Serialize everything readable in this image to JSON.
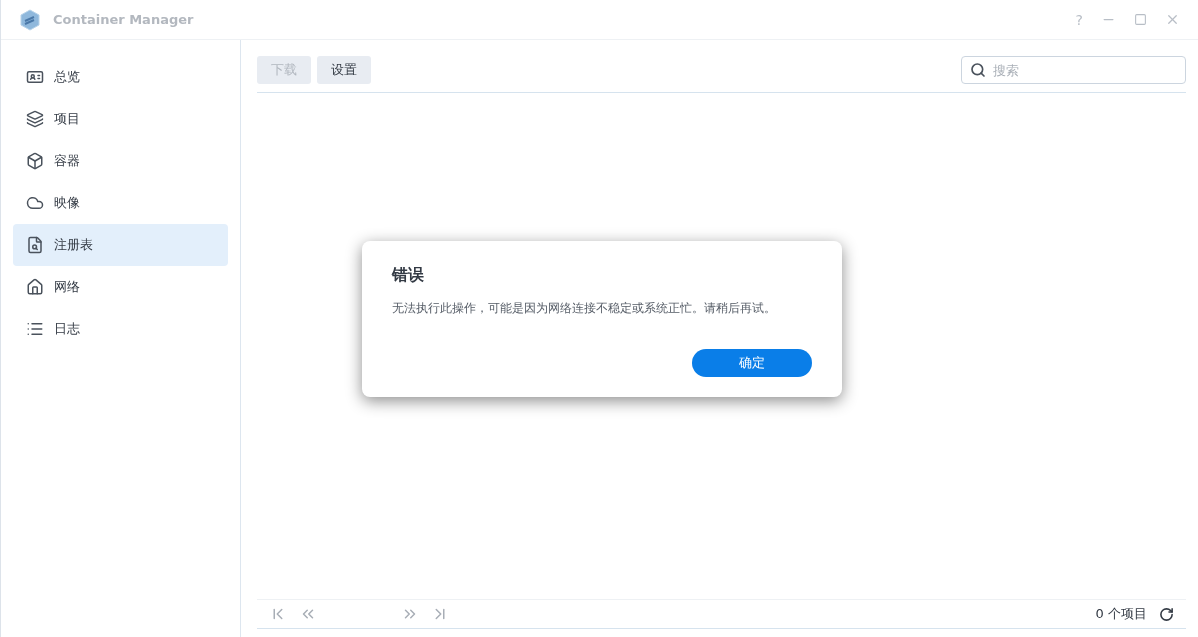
{
  "window": {
    "title": "Container Manager",
    "help": "?"
  },
  "sidebar": {
    "items": [
      {
        "label": "总览",
        "kind": "overview",
        "selected": false
      },
      {
        "label": "项目",
        "kind": "project",
        "selected": false
      },
      {
        "label": "容器",
        "kind": "container",
        "selected": false
      },
      {
        "label": "映像",
        "kind": "image",
        "selected": false
      },
      {
        "label": "注册表",
        "kind": "registry",
        "selected": true
      },
      {
        "label": "网络",
        "kind": "network",
        "selected": false
      },
      {
        "label": "日志",
        "kind": "log",
        "selected": false
      }
    ]
  },
  "toolbar": {
    "buttons": [
      {
        "label": "下载",
        "disabled": true
      },
      {
        "label": "设置",
        "disabled": false
      }
    ],
    "search": {
      "placeholder": "搜索"
    }
  },
  "dialog": {
    "title": "错误",
    "message": "无法执行此操作，可能是因为网络连接不稳定或系统正忙。请稍后再试。",
    "button": "确定"
  },
  "footer": {
    "count": "0 个项目"
  }
}
